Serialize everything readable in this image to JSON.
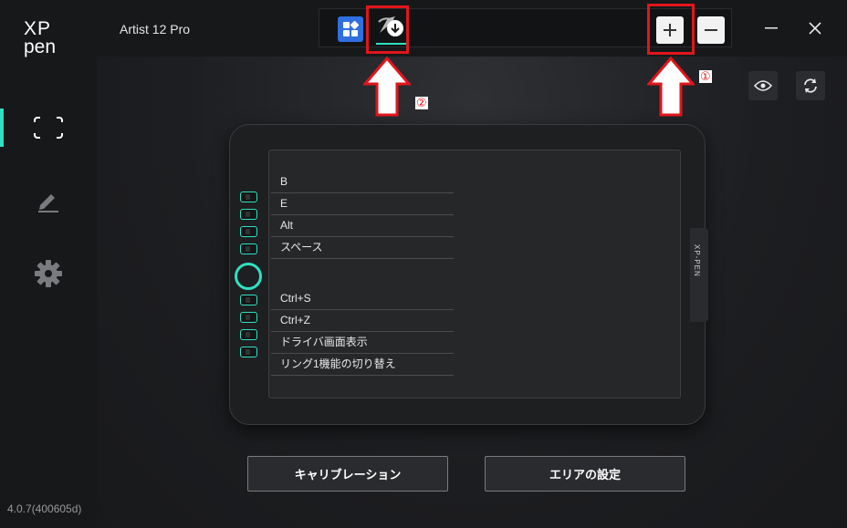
{
  "app": {
    "version": "4.0.7(400605d)"
  },
  "logo": {
    "line1": "XP",
    "line2": "pen"
  },
  "header": {
    "title": "Artist 12 Pro"
  },
  "annotations": {
    "label_1": "①",
    "label_2": "②",
    "highlight_color": "#e0161c"
  },
  "tablet": {
    "brand": "XP-PEN",
    "key_labels": [
      "B",
      "E",
      "Alt",
      "スペース",
      "Ctrl+S",
      "Ctrl+Z",
      "ドライバ画面表示",
      "リング1機能の切り替え"
    ]
  },
  "buttons": {
    "calibration": "キャリブレーション",
    "area_settings": "エリアの設定"
  },
  "colors": {
    "accent": "#2fe0c2",
    "app_tab_blue": "#2f6fe0"
  },
  "icons": {
    "sidebar": [
      "fullscreen-icon",
      "pen-icon",
      "gear-icon"
    ],
    "toolbar": [
      "eye-icon",
      "refresh-icon"
    ]
  }
}
